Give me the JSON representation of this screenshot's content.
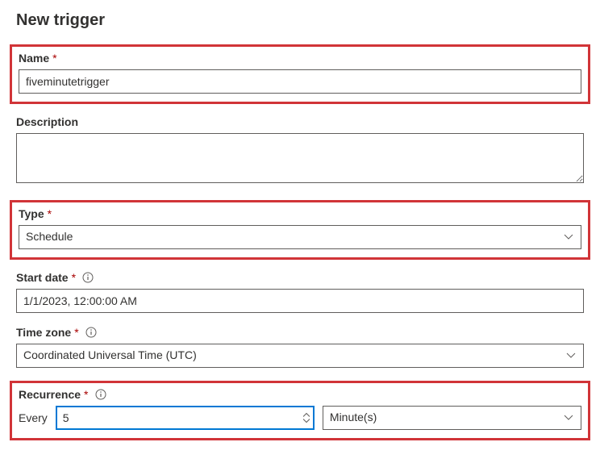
{
  "page_title": "New trigger",
  "fields": {
    "name": {
      "label": "Name",
      "value": "fiveminutetrigger",
      "required": true
    },
    "description": {
      "label": "Description",
      "value": ""
    },
    "type": {
      "label": "Type",
      "value": "Schedule",
      "required": true
    },
    "start_date": {
      "label": "Start date",
      "value": "1/1/2023, 12:00:00 AM",
      "required": true
    },
    "time_zone": {
      "label": "Time zone",
      "value": "Coordinated Universal Time (UTC)",
      "required": true
    },
    "recurrence": {
      "label": "Recurrence",
      "required": true,
      "every_label": "Every",
      "interval_value": "5",
      "unit_value": "Minute(s)"
    }
  },
  "required_marker": "*",
  "icons": {
    "info": "info-icon",
    "chevron_down": "chevron-down-icon"
  }
}
